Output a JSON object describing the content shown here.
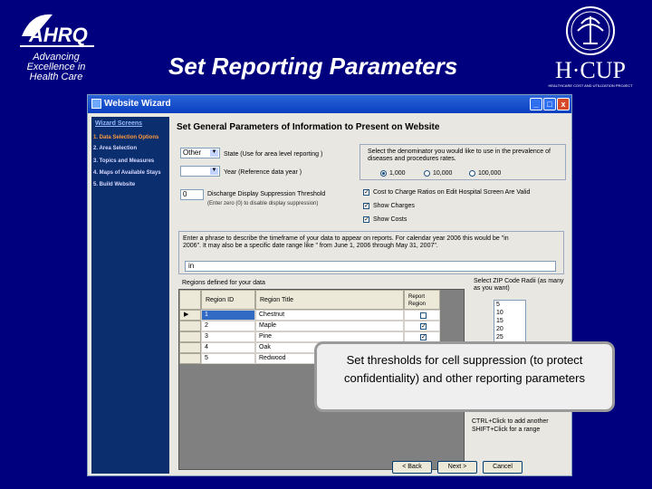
{
  "header": {
    "logo_text": "AHRQ",
    "tagline": [
      "Advancing",
      "Excellence in",
      "Health Care"
    ],
    "title": "Set Reporting Parameters",
    "hcup_text": "H·CUP",
    "hcup_subtitle": "HEALTHCARE COST AND UTILIZATION PROJECT"
  },
  "window": {
    "title": "Website Wizard",
    "min": "_",
    "max": "□",
    "close": "x"
  },
  "nav": {
    "header": "Wizard Screens",
    "items": [
      "1. Data Selection Options",
      "2. Area Selection",
      "3. Topics and Measures",
      "4. Maps of Available Stays",
      "5. Build Website"
    ]
  },
  "main": {
    "heading": "Set General Parameters of Information to Present on Website",
    "state_select": "Other",
    "state_label": "State (Use for area level reporting )",
    "year_label": "Year (Reference data year )",
    "threshold_value": "0",
    "threshold_label": "Discharge Display Suppression Threshold",
    "threshold_sub": "(Enter zero (0) to disable display suppression)",
    "denominator_text": "Select the denominator you would like to use in the prevalence of diseases and procedures rates.",
    "radios": [
      "1,000",
      "10,000",
      "100,000"
    ],
    "checks": [
      "Cost to Charge Ratios on Edit Hospital Screen Are Valid",
      "Show Charges",
      "Show Costs"
    ],
    "phrase_text": "Enter a phrase to describe the timeframe of your data to appear on reports. For calendar year 2006 this would be \"in 2006\". It may also be a specific date range like \" from June 1, 2006 through May 31, 2007\".",
    "phrase_value": "in",
    "regions_label": "Regions defined for your data",
    "zip_label": "Select ZIP Code Radii (as many as you want)",
    "zip_values": [
      "5",
      "10",
      "15",
      "20",
      "25"
    ],
    "zip_help": "CTRL+Click to add another SHIFT+Click for a range",
    "table": {
      "headers": [
        "Region ID",
        "Region Title",
        "Report Region"
      ],
      "rows": [
        {
          "id": "1",
          "title": "Chestnut"
        },
        {
          "id": "2",
          "title": "Maple"
        },
        {
          "id": "3",
          "title": "Pine"
        },
        {
          "id": "4",
          "title": "Oak"
        },
        {
          "id": "5",
          "title": "Redwood"
        }
      ]
    },
    "buttons": {
      "back": "< Back",
      "next": "Next >",
      "cancel": "Cancel"
    }
  },
  "callout": "Set thresholds for cell suppression (to protect confidentiality) and other reporting parameters",
  "colors": {
    "background": "#00007f",
    "selected_nav": "#ff9a3c"
  }
}
